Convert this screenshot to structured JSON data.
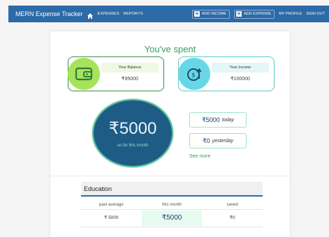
{
  "navbar": {
    "brand": "MERN Expense Tracker",
    "icon": "home-icon",
    "links": [
      "EXPENSES",
      "REPORTS"
    ],
    "add_income": "ADD INCOME",
    "add_expense": "ADD EXPENSE",
    "my_profile": "MY PROFILE",
    "sign_out": "SIGN OUT"
  },
  "summary": {
    "title": "You've spent",
    "balance": {
      "label": "Your Balance",
      "value": "₹95000",
      "icon": "wallet-icon"
    },
    "income": {
      "label": "Your Income",
      "value": "₹100000",
      "icon": "money-upload-icon"
    },
    "month_amount": "₹5000",
    "month_label": "so far this month",
    "today_amount": "₹5000",
    "today_label": "today",
    "yesterday_amount": "₹0",
    "yesterday_label": "yesterday",
    "see_more": "See more"
  },
  "category": {
    "name": "Education",
    "columns": [
      "past average",
      "this month",
      "saved"
    ],
    "values": [
      "₹ 5000",
      "₹5000",
      "₹0"
    ]
  },
  "colors": {
    "navbar": "#2c6aa8",
    "accent_green": "#2f9e5e",
    "balance_circle": "#a6e35a",
    "income_circle": "#67d7e8",
    "month_circle": "#1e5c86"
  }
}
